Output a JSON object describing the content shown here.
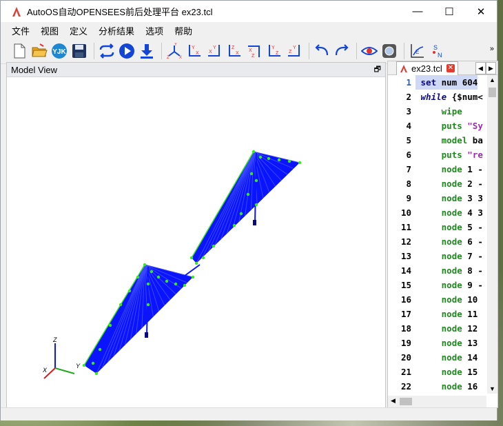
{
  "window": {
    "title": "AutoOS自动OPENSEES前后处理平台 ex23.tcl",
    "controls": {
      "minimize": "—",
      "maximize": "☐",
      "close": "✕"
    }
  },
  "menu": [
    "文件",
    "视图",
    "定义",
    "分析结果",
    "选项",
    "帮助"
  ],
  "toolbar": {
    "items": [
      "new-file-icon",
      "open-folder-icon",
      "yjk-icon",
      "save-icon",
      "loop-icon",
      "run-icon",
      "download-icon",
      "axis-xyz-icon",
      "view-yx-icon",
      "view-xy-icon",
      "view-zx-icon",
      "view-xz-icon",
      "view-yz-icon",
      "view-zy-icon",
      "undo-icon",
      "redo-icon",
      "eye-icon",
      "camera-icon",
      "chart-icon",
      "sn-icon"
    ],
    "more": "»"
  },
  "model_view": {
    "title": "Model View",
    "restore": "🗗",
    "axes": {
      "x": "X",
      "y": "Y",
      "z": "Z"
    }
  },
  "editor": {
    "tab": "ex23.tcl",
    "lines": [
      {
        "n": "1",
        "t": "set num 604"
      },
      {
        "n": "2",
        "t": "while {$num<"
      },
      {
        "n": "3",
        "t": "    wipe"
      },
      {
        "n": "4",
        "t": "    puts \"Sy"
      },
      {
        "n": "5",
        "t": "    model ba"
      },
      {
        "n": "6",
        "t": "    puts \"re"
      },
      {
        "n": "7",
        "t": "    node 1 -"
      },
      {
        "n": "8",
        "t": "    node 2 -"
      },
      {
        "n": "9",
        "t": "    node 3 3"
      },
      {
        "n": "10",
        "t": "    node 4 3"
      },
      {
        "n": "11",
        "t": "    node 5 -"
      },
      {
        "n": "12",
        "t": "    node 6 -"
      },
      {
        "n": "13",
        "t": "    node 7 -"
      },
      {
        "n": "14",
        "t": "    node 8 -"
      },
      {
        "n": "15",
        "t": "    node 9 -"
      },
      {
        "n": "16",
        "t": "    node 10"
      },
      {
        "n": "17",
        "t": "    node 11"
      },
      {
        "n": "18",
        "t": "    node 12"
      },
      {
        "n": "19",
        "t": "    node 13"
      },
      {
        "n": "20",
        "t": "    node 14"
      },
      {
        "n": "21",
        "t": "    node 15"
      },
      {
        "n": "22",
        "t": "    node 16"
      }
    ]
  },
  "colors": {
    "model_blue": "#0a14ff",
    "node_green": "#39e81f"
  }
}
